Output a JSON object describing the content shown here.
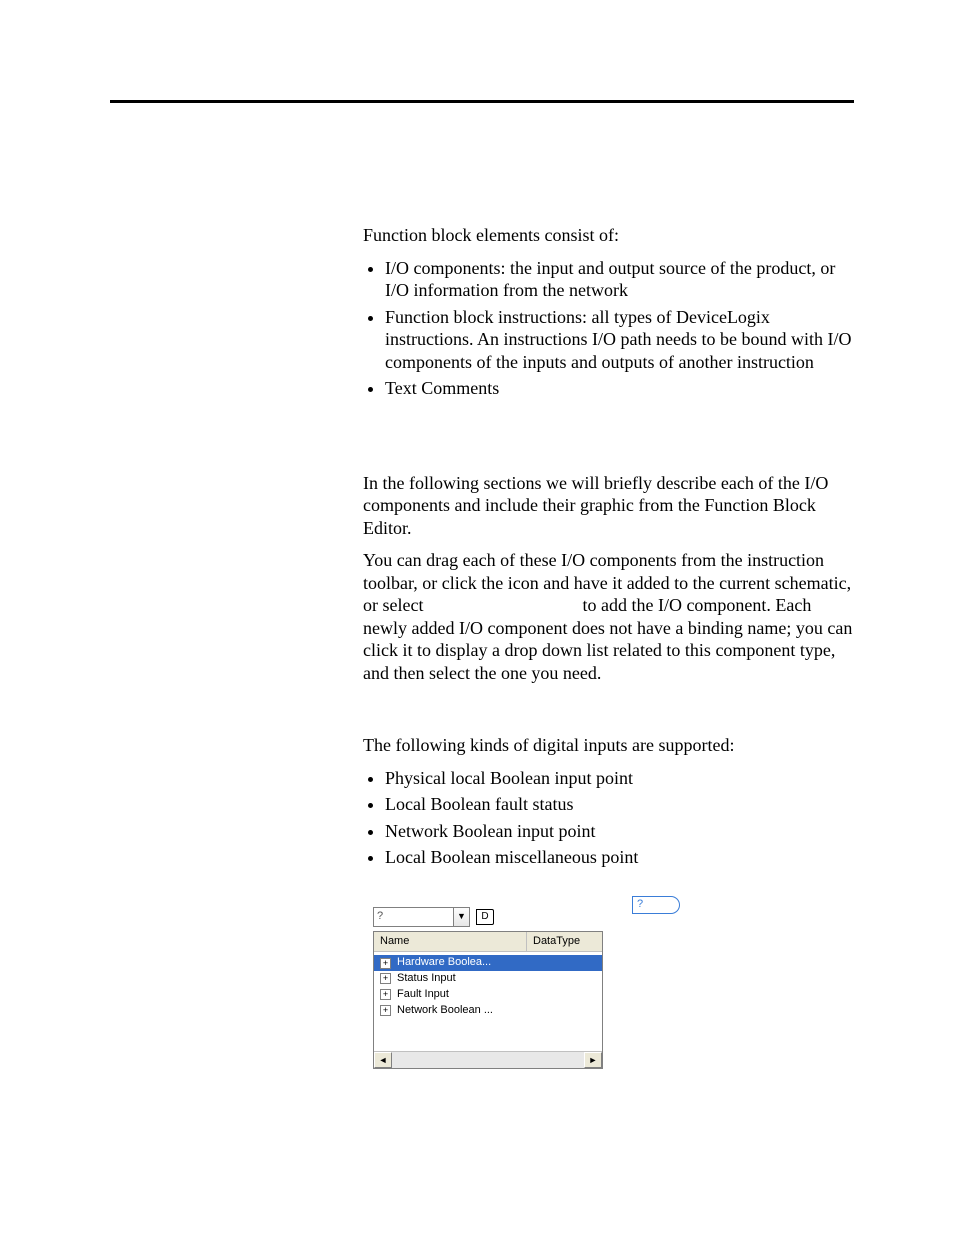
{
  "intro": "Function block elements consist of:",
  "bullets1": [
    "I/O components: the input and output source of the product, or I/O information from the network",
    "Function block instructions: all types of DeviceLogix instructions. An instructions I/O path needs to be bound with I/O components of the inputs and outputs of another instruction",
    "Text Comments"
  ],
  "p2": "In the following sections we will briefly describe each of the I/O components and include their graphic from the Function Block Editor.",
  "p3a": "You can drag each of these I/O components from the instruction toolbar, or click the icon and have it added to the current schematic, or select",
  "p3b": "to add the I/O component.  Each newly added I/O component does not have a binding name;   you can click it to display a drop down list related to this component type, and then select the one you need.",
  "p4": "The following kinds of digital inputs are supported:",
  "bullets2": [
    "Physical local Boolean input point",
    "Local Boolean fault status",
    "Network Boolean input point",
    "Local Boolean miscellaneous point"
  ],
  "widget": {
    "comboText": "?",
    "tag": "D",
    "headers": {
      "name": "Name",
      "datatype": "DataType"
    },
    "rows": [
      {
        "label": "Hardware Boolea...",
        "selected": true
      },
      {
        "label": "Status Input",
        "selected": false
      },
      {
        "label": "Fault Input",
        "selected": false
      },
      {
        "label": "Network Boolean ...",
        "selected": false
      }
    ]
  },
  "dIcon": {
    "text": "?"
  }
}
